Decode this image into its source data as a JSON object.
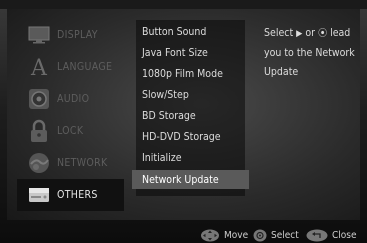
{
  "categories": [
    {
      "label": "DISPLAY",
      "icon": "display-icon"
    },
    {
      "label": "LANGUAGE",
      "icon": "language-icon"
    },
    {
      "label": "AUDIO",
      "icon": "audio-icon"
    },
    {
      "label": "LOCK",
      "icon": "lock-icon"
    },
    {
      "label": "NETWORK",
      "icon": "network-icon"
    },
    {
      "label": "OTHERS",
      "icon": "others-icon"
    }
  ],
  "active_category": "OTHERS",
  "submenu": [
    "Button Sound",
    "Java Font Size",
    "1080p Film Mode",
    "Slow/Step",
    "BD Storage",
    "HD-DVD Storage",
    "Initialize",
    "Network Update"
  ],
  "active_submenu": "Network Update",
  "info": {
    "line1_pre": "Select",
    "arrow_symbol": "▶",
    "line1_mid": "or",
    "enter_symbol": "⦿",
    "line1_post": "lead",
    "line2": "you to the Network",
    "line3": "Update"
  },
  "footer": {
    "move_label": "Move",
    "select_label": "Select",
    "close_label": "Close"
  },
  "colors": {
    "active_item_bg": "#5a5a5a",
    "active_category_bg": "#111111",
    "inactive_category_text": "#5d5d5d",
    "text": "#dcdcdc"
  }
}
